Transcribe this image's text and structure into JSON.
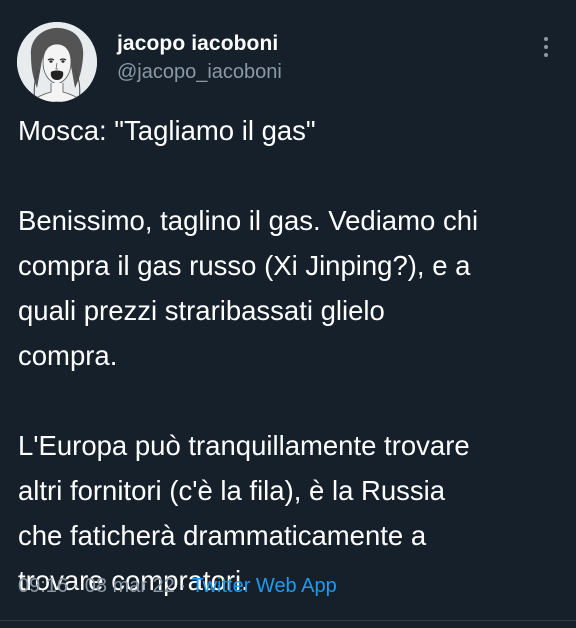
{
  "tweet": {
    "author": {
      "display_name": "jacopo iacoboni",
      "handle": "@jacopo_iacoboni",
      "avatar_icon": "profile-photo-icon"
    },
    "more_icon": "more-vertical-icon",
    "text_paragraphs": [
      [
        "Mosca: \"Tagliamo il gas\""
      ],
      [
        "Benissimo, taglino il gas. Vediamo chi",
        "compra il gas russo (Xi Jinping?), e a",
        "quali prezzi straribassati glielo",
        "compra."
      ],
      [
        "L'Europa può tranquillamente trovare",
        "altri fornitori (c'è la fila), è la Russia",
        "che faticherà drammaticamente a",
        "trovare compratori."
      ]
    ],
    "meta": {
      "time": "09:16",
      "separator": "·",
      "date": "08 mar 22",
      "source": "Twitter Web App"
    }
  },
  "colors": {
    "background": "#15202b",
    "primary_text": "#ffffff",
    "secondary_text": "#8b98a5",
    "link": "#1d9bf0"
  }
}
